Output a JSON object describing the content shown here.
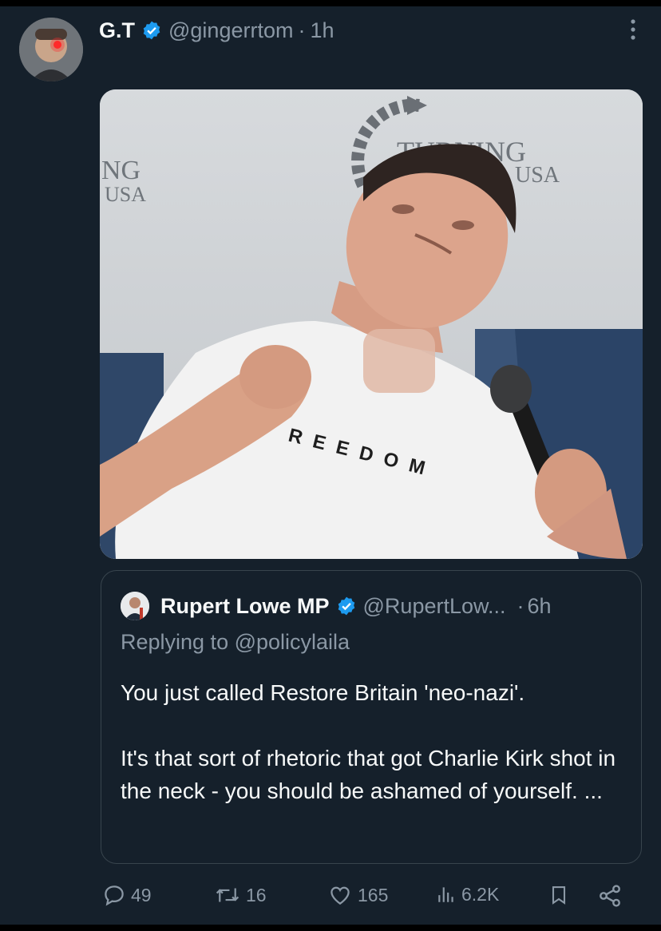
{
  "tweet": {
    "author_name": "G.T",
    "handle": "@gingerrtom",
    "separator": "·",
    "time": "1h",
    "verified_icon": "verified-badge-icon",
    "more_icon": "more-vertical-icon"
  },
  "media": {
    "sign_left": [
      "NG",
      "USA"
    ],
    "sign_center": [
      "TURNING",
      "USA"
    ],
    "shirt_text": "REEDOM"
  },
  "quoted_tweet": {
    "author_name": "Rupert Lowe MP",
    "handle": "@RupertLow...",
    "separator": "·",
    "time": "6h",
    "replying_prefix": "Replying to",
    "replying_handle": "@policylaila",
    "text_1": "You just called Restore Britain 'neo-nazi'.",
    "text_2": "It's that sort of rhetoric that got Charlie Kirk shot in the neck - you should be ashamed of yourself. ..."
  },
  "actions": {
    "replies": "49",
    "retweets": "16",
    "likes": "165",
    "views": "6.2K",
    "icons": [
      "reply-icon",
      "retweet-icon",
      "like-icon",
      "views-icon",
      "bookmark-icon",
      "share-icon"
    ]
  },
  "colors": {
    "background": "#15202b",
    "muted": "#8b98a5",
    "verified": "#1d9bf0",
    "text": "#f7f9f9"
  }
}
